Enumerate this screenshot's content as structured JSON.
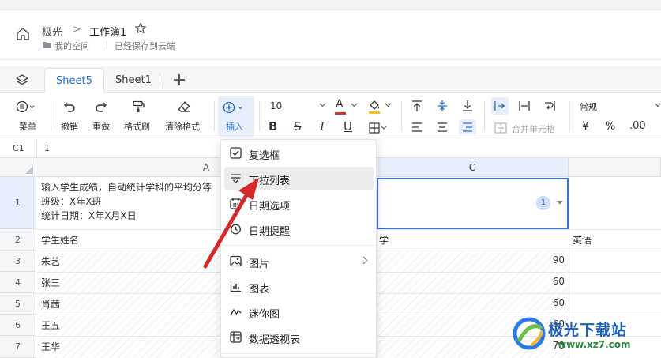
{
  "header": {
    "breadcrumb_root": "极光",
    "breadcrumb_sep": ">",
    "title": "工作簿1",
    "space_label": "我的空间",
    "save_status": "已经保存到云端"
  },
  "tabs": [
    {
      "label": "Sheet5",
      "active": true
    },
    {
      "label": "Sheet1",
      "active": false
    }
  ],
  "toolbar": {
    "menu_label": "菜单",
    "undo_label": "撤销",
    "redo_label": "重做",
    "format_painter_label": "格式刷",
    "clear_format_label": "清除格式",
    "insert_label": "插入",
    "font_size": "10",
    "font_color_letter": "A",
    "merge_label": "合并单元格",
    "number_format": "常规",
    "currency_symbol": "¥",
    "percent_symbol": "%",
    "decimal_label": ".00"
  },
  "formula_bar": {
    "cell_ref": "C1",
    "value": "1"
  },
  "grid": {
    "columns": [
      "A",
      "C"
    ],
    "rows": [
      "1",
      "2",
      "3",
      "4",
      "5",
      "6",
      "7"
    ],
    "a1_lines": [
      "输入学生成绩，自动统计学科的平均分等",
      "班级：X年X班",
      "统计日期：X年X月X日"
    ],
    "c1_badge": "1",
    "a2": "学生姓名",
    "c2": "学",
    "d2": "英语",
    "names": [
      "朱艺",
      "张三",
      "肖茜",
      "王五",
      "王华"
    ],
    "c_values": [
      "90",
      "60",
      "60",
      "60",
      "70"
    ]
  },
  "insert_menu": {
    "items": [
      {
        "label": "复选框",
        "icon": "checkbox-icon"
      },
      {
        "label": "下拉列表",
        "icon": "dropdown-list-icon",
        "highlighted": true
      },
      {
        "label": "日期选项",
        "icon": "calendar-icon"
      },
      {
        "label": "日期提醒",
        "icon": "alarm-icon"
      },
      {
        "label": "图片",
        "icon": "image-icon",
        "submenu": true
      },
      {
        "label": "图表",
        "icon": "chart-icon"
      },
      {
        "label": "迷你图",
        "icon": "sparkline-icon"
      },
      {
        "label": "数据透视表",
        "icon": "pivot-table-icon"
      }
    ]
  },
  "watermark": {
    "name": "极光下载站",
    "url": "www.xz7.com"
  },
  "colors": {
    "accent": "#1f6fd0",
    "selection": "#3b73d9",
    "annotation_arrow": "#d42a2a"
  }
}
